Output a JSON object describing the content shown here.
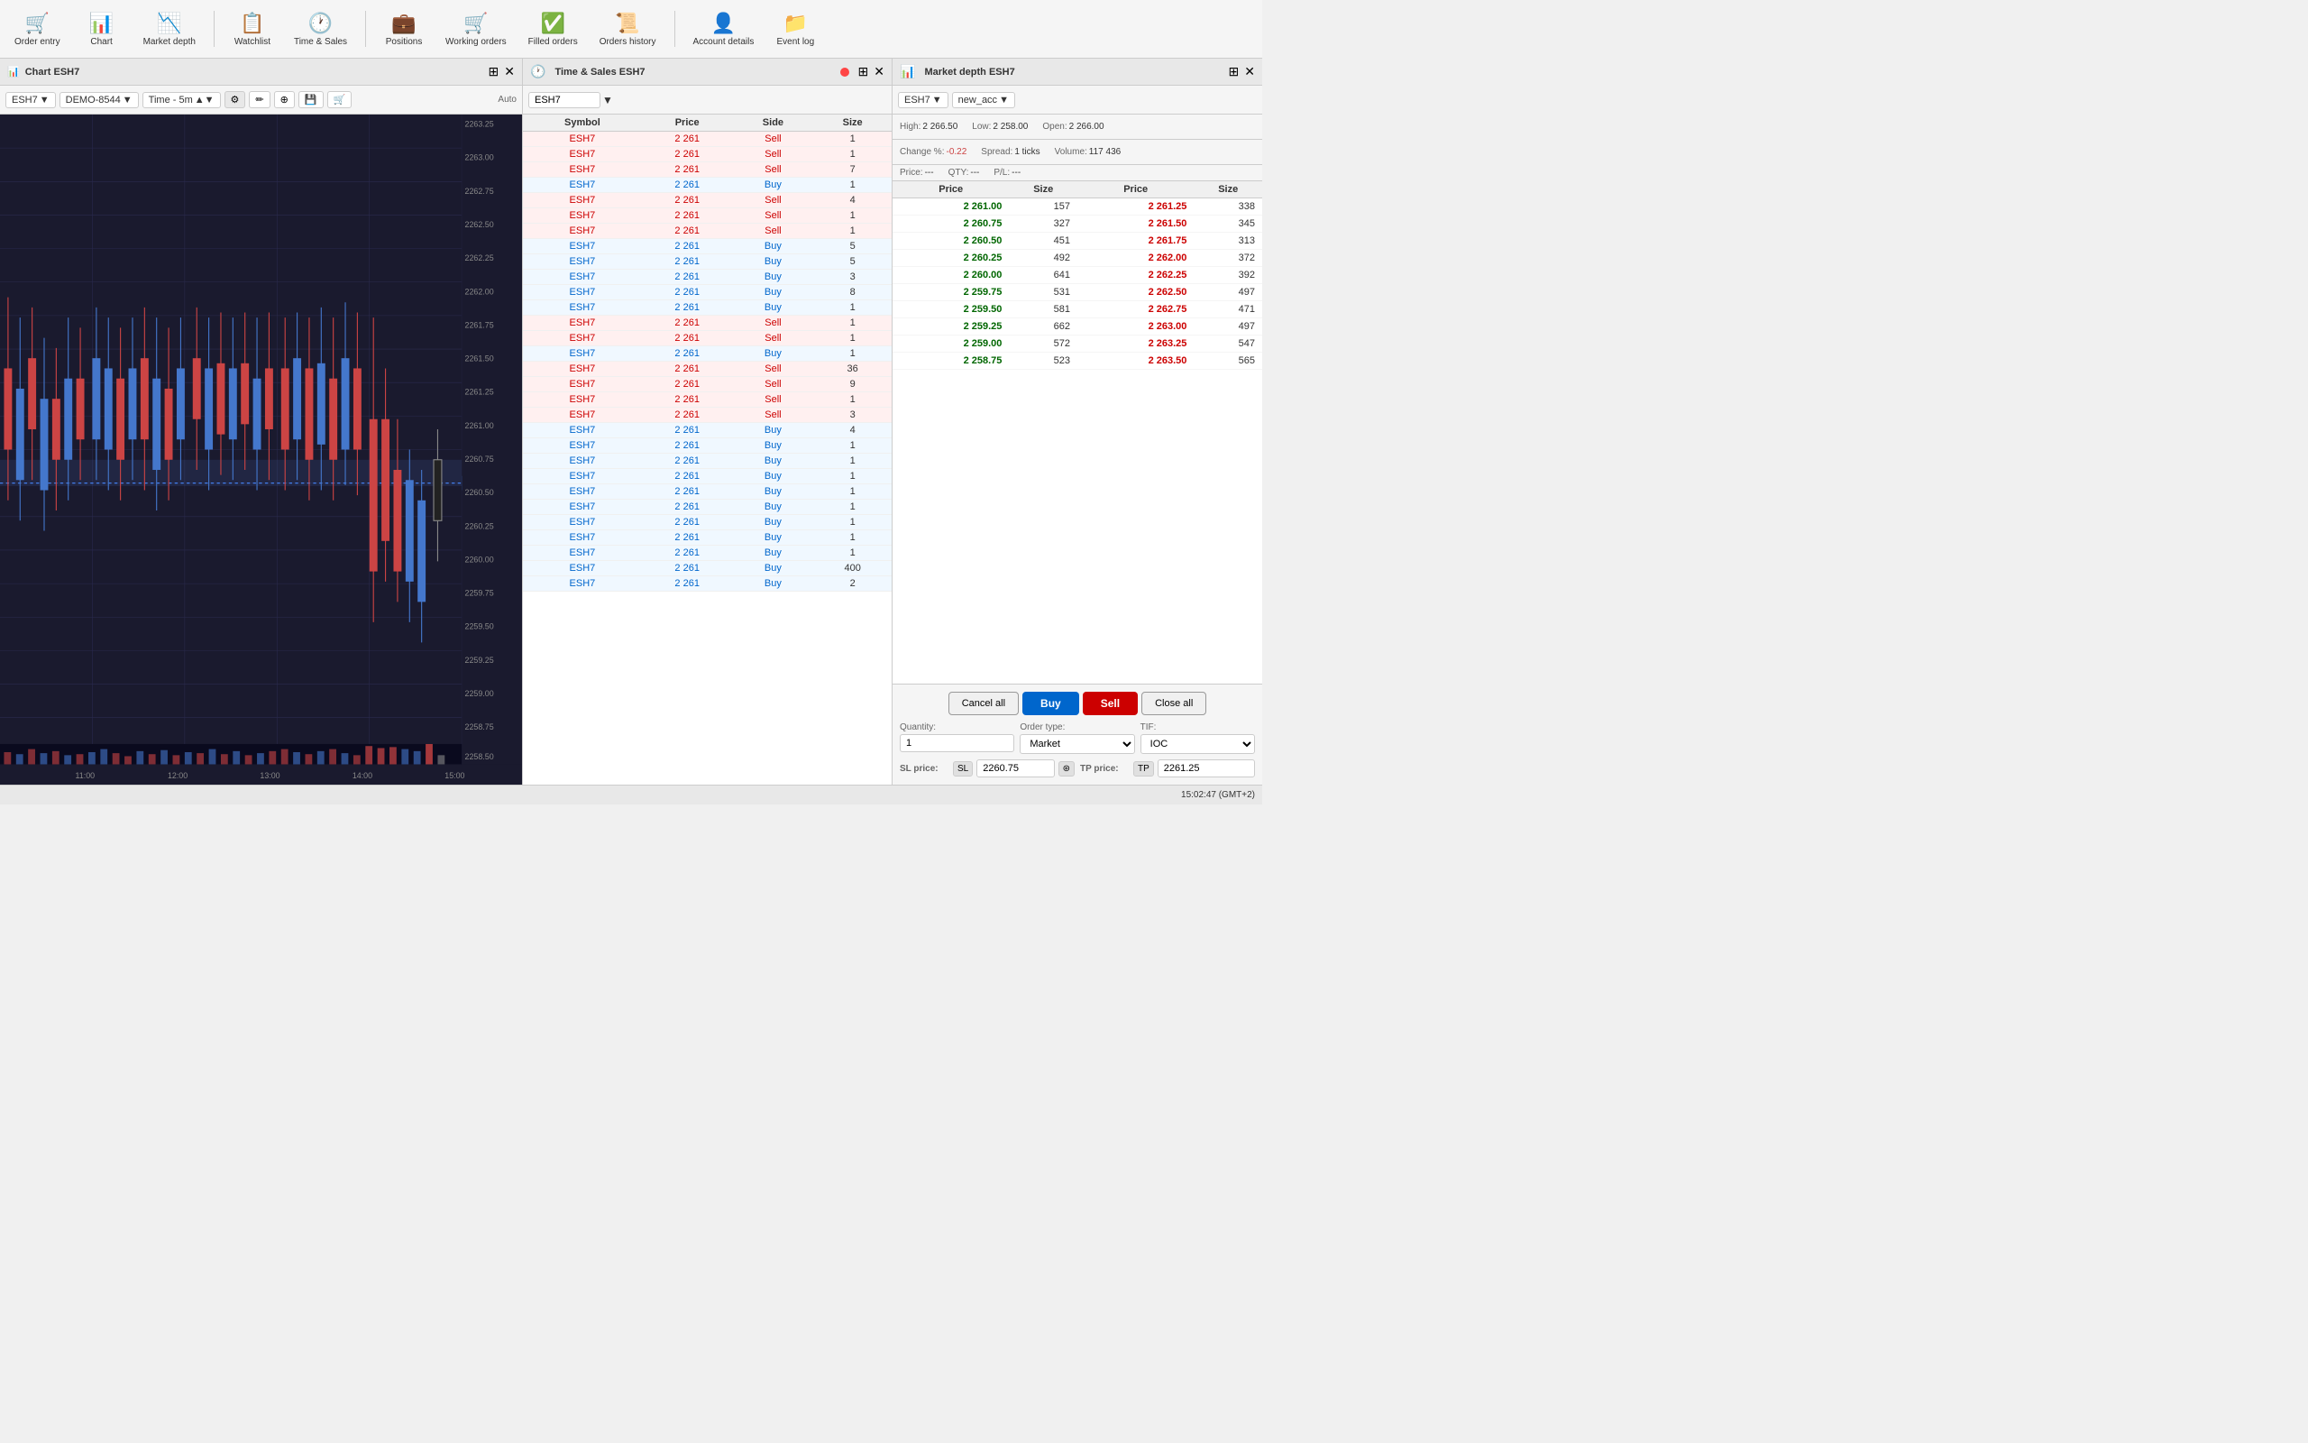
{
  "toolbar": {
    "items": [
      {
        "id": "order-entry",
        "label": "Order entry",
        "icon": "🛒"
      },
      {
        "id": "chart",
        "label": "Chart",
        "icon": "📊"
      },
      {
        "id": "market-depth",
        "label": "Market depth",
        "icon": "📉"
      },
      {
        "id": "watchlist",
        "label": "Watchlist",
        "icon": "📋"
      },
      {
        "id": "time-sales",
        "label": "Time & Sales",
        "icon": "🕐"
      },
      {
        "id": "positions",
        "label": "Positions",
        "icon": "💼"
      },
      {
        "id": "working-orders",
        "label": "Working orders",
        "icon": "🛒"
      },
      {
        "id": "filled-orders",
        "label": "Filled orders",
        "icon": "✅"
      },
      {
        "id": "orders-history",
        "label": "Orders history",
        "icon": "📜"
      },
      {
        "id": "account-details",
        "label": "Account details",
        "icon": "👤"
      },
      {
        "id": "event-log",
        "label": "Event log",
        "icon": "📁"
      }
    ]
  },
  "chart": {
    "header": "Chart ESH7",
    "symbol": "ESH7",
    "account": "DEMO-8544",
    "timeframe": "Time - 5m",
    "prices": [
      "2263.25",
      "2263.00",
      "2262.75",
      "2262.50",
      "2262.25",
      "2262.00",
      "2261.75",
      "2261.50",
      "2261.25",
      "2261.00",
      "2260.75",
      "2260.50",
      "2260.25",
      "2260.00",
      "2259.75",
      "2259.50",
      "2259.25",
      "2259.00",
      "2258.75",
      "2258.50"
    ],
    "times": [
      "11:00",
      "12:00",
      "13:00",
      "14:00",
      "15:00"
    ],
    "current_price": "2261.00"
  },
  "time_sales": {
    "header": "Time & Sales ESH7",
    "symbol": "ESH7",
    "columns": [
      "Symbol",
      "Price",
      "Side",
      "Size"
    ],
    "rows": [
      {
        "symbol": "ESH7",
        "price": "2 261",
        "side": "Sell",
        "size": "1"
      },
      {
        "symbol": "ESH7",
        "price": "2 261",
        "side": "Sell",
        "size": "1"
      },
      {
        "symbol": "ESH7",
        "price": "2 261",
        "side": "Sell",
        "size": "7"
      },
      {
        "symbol": "ESH7",
        "price": "2 261",
        "side": "Buy",
        "size": "1"
      },
      {
        "symbol": "ESH7",
        "price": "2 261",
        "side": "Sell",
        "size": "4"
      },
      {
        "symbol": "ESH7",
        "price": "2 261",
        "side": "Sell",
        "size": "1"
      },
      {
        "symbol": "ESH7",
        "price": "2 261",
        "side": "Sell",
        "size": "1"
      },
      {
        "symbol": "ESH7",
        "price": "2 261",
        "side": "Buy",
        "size": "5"
      },
      {
        "symbol": "ESH7",
        "price": "2 261",
        "side": "Buy",
        "size": "5"
      },
      {
        "symbol": "ESH7",
        "price": "2 261",
        "side": "Buy",
        "size": "3"
      },
      {
        "symbol": "ESH7",
        "price": "2 261",
        "side": "Buy",
        "size": "8"
      },
      {
        "symbol": "ESH7",
        "price": "2 261",
        "side": "Buy",
        "size": "1"
      },
      {
        "symbol": "ESH7",
        "price": "2 261",
        "side": "Sell",
        "size": "1"
      },
      {
        "symbol": "ESH7",
        "price": "2 261",
        "side": "Sell",
        "size": "1"
      },
      {
        "symbol": "ESH7",
        "price": "2 261",
        "side": "Buy",
        "size": "1"
      },
      {
        "symbol": "ESH7",
        "price": "2 261",
        "side": "Sell",
        "size": "36"
      },
      {
        "symbol": "ESH7",
        "price": "2 261",
        "side": "Sell",
        "size": "9"
      },
      {
        "symbol": "ESH7",
        "price": "2 261",
        "side": "Sell",
        "size": "1"
      },
      {
        "symbol": "ESH7",
        "price": "2 261",
        "side": "Sell",
        "size": "3"
      },
      {
        "symbol": "ESH7",
        "price": "2 261",
        "side": "Buy",
        "size": "4"
      },
      {
        "symbol": "ESH7",
        "price": "2 261",
        "side": "Buy",
        "size": "1"
      },
      {
        "symbol": "ESH7",
        "price": "2 261",
        "side": "Buy",
        "size": "1"
      },
      {
        "symbol": "ESH7",
        "price": "2 261",
        "side": "Buy",
        "size": "1"
      },
      {
        "symbol": "ESH7",
        "price": "2 261",
        "side": "Buy",
        "size": "1"
      },
      {
        "symbol": "ESH7",
        "price": "2 261",
        "side": "Buy",
        "size": "1"
      },
      {
        "symbol": "ESH7",
        "price": "2 261",
        "side": "Buy",
        "size": "1"
      },
      {
        "symbol": "ESH7",
        "price": "2 261",
        "side": "Buy",
        "size": "1"
      },
      {
        "symbol": "ESH7",
        "price": "2 261",
        "side": "Buy",
        "size": "1"
      },
      {
        "symbol": "ESH7",
        "price": "2 261",
        "side": "Buy",
        "size": "400"
      },
      {
        "symbol": "ESH7",
        "price": "2 261",
        "side": "Buy",
        "size": "2"
      }
    ]
  },
  "market_depth": {
    "header": "Market depth ESH7",
    "symbol": "ESH7",
    "account": "new_acc",
    "high": "2 266.50",
    "low": "2 258.00",
    "open": "2 266.00",
    "change_pct": "-0.22",
    "spread": "1 ticks",
    "volume": "117 436",
    "price": "---",
    "qty": "---",
    "pnl": "---",
    "columns": [
      "Price",
      "Size",
      "Price",
      "Size"
    ],
    "rows": [
      {
        "bid_price": "2 261.00",
        "bid_size": "157",
        "ask_price": "2 261.25",
        "ask_size": "338"
      },
      {
        "bid_price": "2 260.75",
        "bid_size": "327",
        "ask_price": "2 261.50",
        "ask_size": "345"
      },
      {
        "bid_price": "2 260.50",
        "bid_size": "451",
        "ask_price": "2 261.75",
        "ask_size": "313"
      },
      {
        "bid_price": "2 260.25",
        "bid_size": "492",
        "ask_price": "2 262.00",
        "ask_size": "372"
      },
      {
        "bid_price": "2 260.00",
        "bid_size": "641",
        "ask_price": "2 262.25",
        "ask_size": "392"
      },
      {
        "bid_price": "2 259.75",
        "bid_size": "531",
        "ask_price": "2 262.50",
        "ask_size": "497"
      },
      {
        "bid_price": "2 259.50",
        "bid_size": "581",
        "ask_price": "2 262.75",
        "ask_size": "471"
      },
      {
        "bid_price": "2 259.25",
        "bid_size": "662",
        "ask_price": "2 263.00",
        "ask_size": "497"
      },
      {
        "bid_price": "2 259.00",
        "bid_size": "572",
        "ask_price": "2 263.25",
        "ask_size": "547"
      },
      {
        "bid_price": "2 258.75",
        "bid_size": "523",
        "ask_price": "2 263.50",
        "ask_size": "565"
      }
    ],
    "order": {
      "cancel_all": "Cancel all",
      "buy": "Buy",
      "sell": "Sell",
      "close_all": "Close all",
      "quantity_label": "Quantity:",
      "quantity_value": "1",
      "order_type_label": "Order type:",
      "order_type_value": "Market",
      "tif_label": "TIF:",
      "tif_value": "IOC",
      "sl_label": "SL price:",
      "sl_value": "2260.75",
      "tp_label": "TP price:",
      "tp_value": "2261.25"
    }
  },
  "status_bar": {
    "time": "15:02:47 (GMT+2)"
  }
}
